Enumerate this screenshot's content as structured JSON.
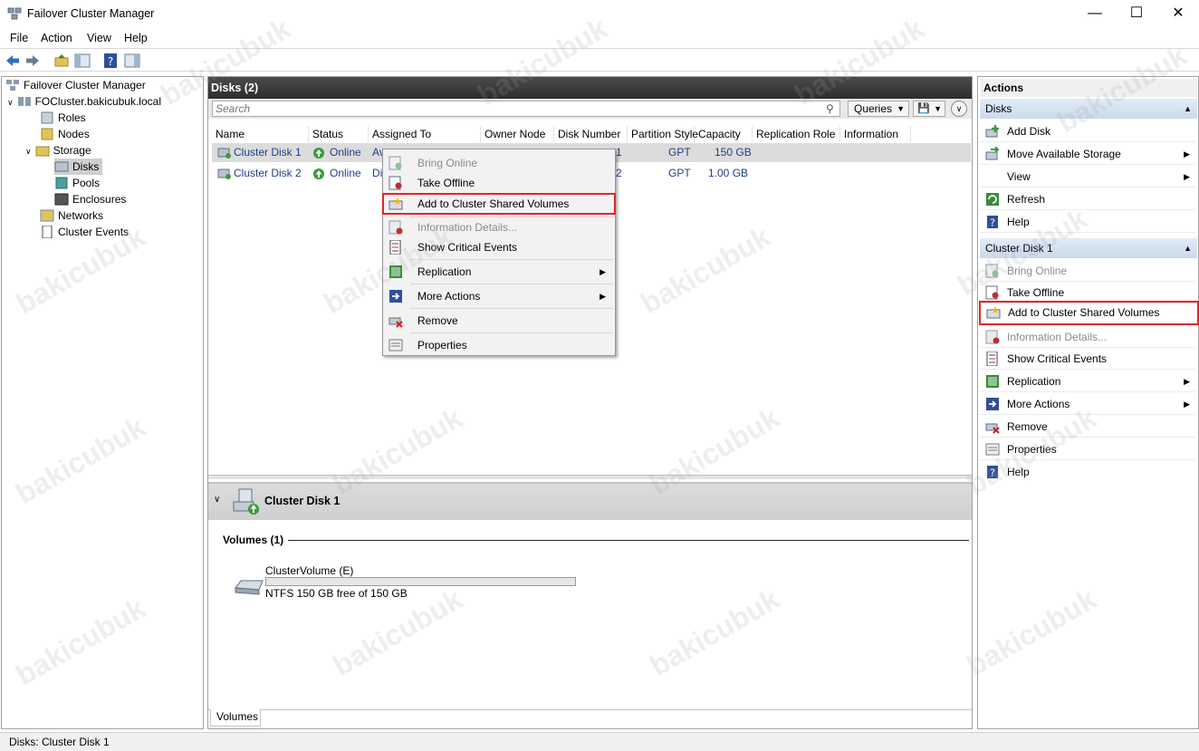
{
  "window": {
    "title": "Failover Cluster Manager"
  },
  "menu": [
    "File",
    "Action",
    "View",
    "Help"
  ],
  "tree": {
    "root": "Failover Cluster Manager",
    "cluster": "FOCluster.bakicubuk.local",
    "items": [
      "Roles",
      "Nodes",
      "Storage",
      "Disks",
      "Pools",
      "Enclosures",
      "Networks",
      "Cluster Events"
    ]
  },
  "center": {
    "title": "Disks (2)",
    "search_placeholder": "Search",
    "queries_label": "Queries",
    "columns": [
      "Name",
      "Status",
      "Assigned To",
      "Owner Node",
      "Disk Number",
      "Partition Style",
      "Capacity",
      "Replication Role",
      "Information"
    ],
    "rows": [
      {
        "name": "Cluster Disk 1",
        "status": "Online",
        "assigned": "Av",
        "disk_number": "1",
        "partition": "GPT",
        "capacity": "150 GB"
      },
      {
        "name": "Cluster Disk 2",
        "status": "Online",
        "assigned": "Di",
        "disk_number": "2",
        "partition": "GPT",
        "capacity": "1.00 GB"
      }
    ]
  },
  "context_menu": {
    "items": [
      {
        "label": "Bring Online",
        "disabled": true
      },
      {
        "label": "Take Offline"
      },
      {
        "label": "Add to Cluster Shared Volumes",
        "highlighted": true
      },
      {
        "label": "Information Details...",
        "disabled": true
      },
      {
        "label": "Show Critical Events"
      },
      {
        "label": "Replication",
        "submenu": true
      },
      {
        "label": "More Actions",
        "submenu": true
      },
      {
        "label": "Remove"
      },
      {
        "label": "Properties"
      }
    ]
  },
  "detail": {
    "title": "Cluster Disk 1",
    "volumes_header": "Volumes (1)",
    "volume_name": "ClusterVolume (E)",
    "volume_info": "NTFS 150 GB free of 150 GB",
    "volume_used_fraction": 0.0,
    "tab": "Volumes"
  },
  "actions": {
    "header": "Actions",
    "sections": [
      {
        "title": "Disks",
        "items": [
          "Add Disk",
          "Move Available Storage",
          "View",
          "Refresh",
          "Help"
        ]
      },
      {
        "title": "Cluster Disk 1",
        "items": [
          "Bring Online",
          "Take Offline",
          "Add to Cluster Shared Volumes",
          "Information Details...",
          "Show Critical Events",
          "Replication",
          "More Actions",
          "Remove",
          "Properties",
          "Help"
        ]
      }
    ]
  },
  "status": "Disks:  Cluster Disk 1",
  "watermark": "bakicubuk",
  "colors": {
    "highlight_box": "#e0262b",
    "link_text": "#1e3e8c",
    "header_dark": "#333333"
  }
}
